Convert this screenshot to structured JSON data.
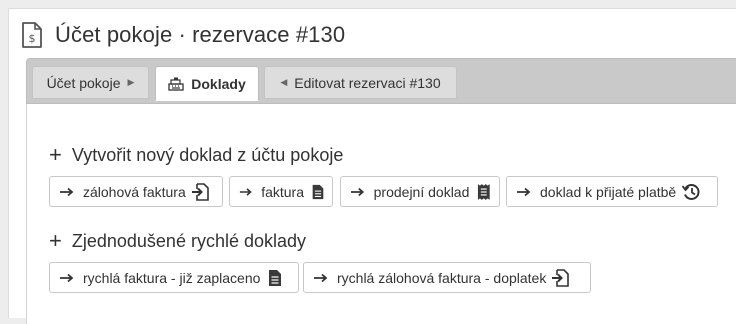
{
  "header": {
    "title": "Účet pokoje · rezervace #130",
    "icon": "invoice-dollar-icon"
  },
  "tabs": [
    {
      "label": "Účet pokoje",
      "icon": "caret-right-icon"
    },
    {
      "label": "Doklady",
      "icon": "cash-register-icon",
      "active": true
    },
    {
      "label": "Editovat rezervaci #130",
      "icon": "caret-left-icon"
    }
  ],
  "sections": [
    {
      "title": "Vytvořit nový doklad z účtu pokoje",
      "buttons": [
        {
          "label": "zálohová faktura",
          "icon": "file-import-icon"
        },
        {
          "label": "faktura",
          "icon": "file-text-icon"
        },
        {
          "label": "prodejní doklad",
          "icon": "receipt-icon"
        },
        {
          "label": "doklad k přijaté platbě",
          "icon": "history-icon"
        }
      ]
    },
    {
      "title": "Zjednodušené rychlé doklady",
      "buttons": [
        {
          "label": "rychlá faktura - již zaplaceno",
          "icon": "file-text-icon"
        },
        {
          "label": "rychlá zálohová faktura - doplatek",
          "icon": "file-import-icon"
        }
      ]
    }
  ]
}
